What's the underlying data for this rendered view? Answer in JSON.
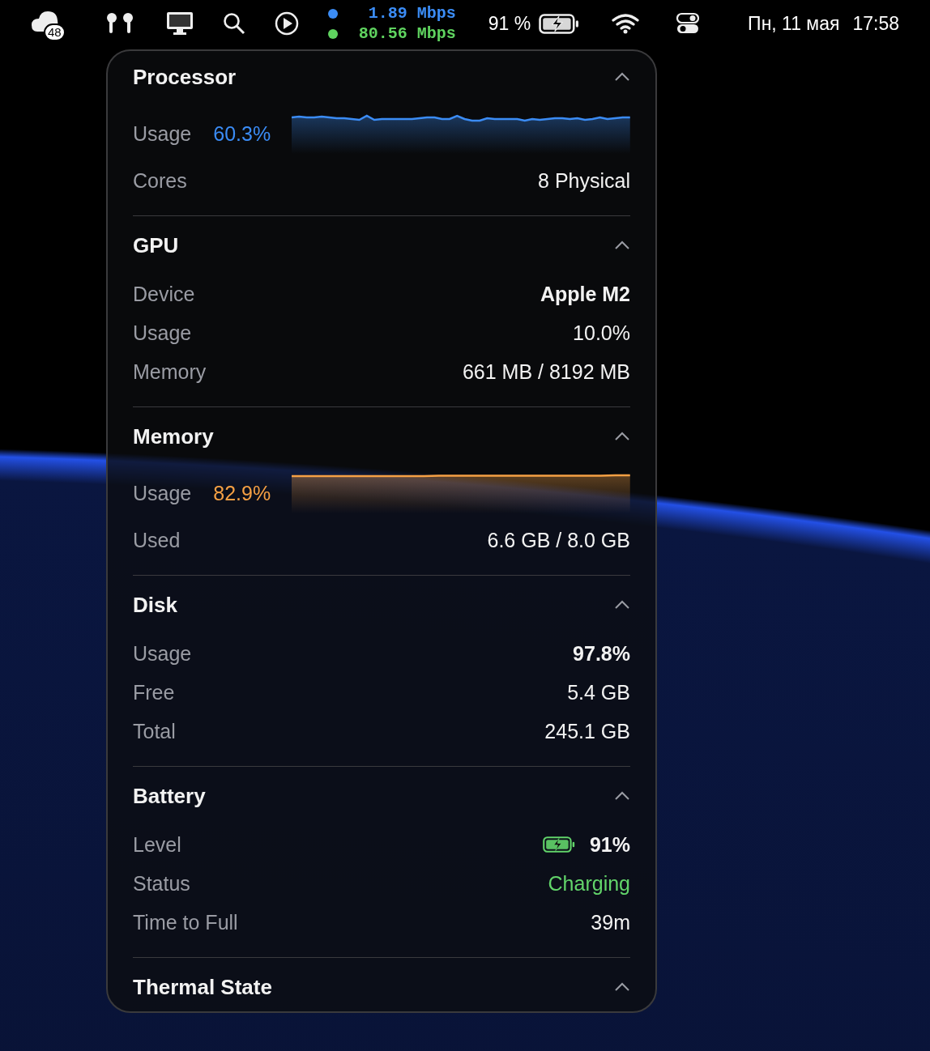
{
  "menu_bar": {
    "badge": "48",
    "network": [
      {
        "rate": "1.89 Mbps",
        "color": "#3b8cf5"
      },
      {
        "rate": "80.56 Mbps",
        "color": "#5fd35f"
      }
    ],
    "battery": "91 %",
    "date": "Пн, 11 мая",
    "time": "17:58"
  },
  "sections": [
    {
      "title": "Processor",
      "expanded": true,
      "rows": [
        {
          "kind": "chart",
          "label": "Usage",
          "value": "60.3%",
          "color": "#3b8cf5"
        },
        {
          "kind": "value",
          "label": "Cores",
          "value": "8 Physical",
          "bold": false
        }
      ]
    },
    {
      "title": "GPU",
      "expanded": true,
      "rows": [
        {
          "kind": "value",
          "label": "Device",
          "value": "Apple M2",
          "bold": true
        },
        {
          "kind": "value",
          "label": "Usage",
          "value": "10.0%",
          "bold": false
        },
        {
          "kind": "value",
          "label": "Memory",
          "value": "661 MB / 8192 MB",
          "bold": false
        }
      ]
    },
    {
      "title": "Memory",
      "expanded": true,
      "rows": [
        {
          "kind": "chart",
          "label": "Usage",
          "value": "82.9%",
          "color": "#f5a044"
        },
        {
          "kind": "value",
          "label": "Used",
          "value": "6.6 GB / 8.0 GB",
          "bold": false
        }
      ]
    },
    {
      "title": "Disk",
      "expanded": true,
      "rows": [
        {
          "kind": "value",
          "label": "Usage",
          "value": "97.8%",
          "bold": true
        },
        {
          "kind": "value",
          "label": "Free",
          "value": "5.4 GB",
          "bold": false
        },
        {
          "kind": "value",
          "label": "Total",
          "value": "245.1 GB",
          "bold": false
        }
      ]
    },
    {
      "title": "Battery",
      "expanded": true,
      "rows": [
        {
          "kind": "battery",
          "label": "Level",
          "value": "91%",
          "bold": true
        },
        {
          "kind": "value",
          "label": "Status",
          "value": "Charging",
          "bold": false,
          "color": "#62d46a"
        },
        {
          "kind": "value",
          "label": "Time to Full",
          "value": "39m",
          "bold": false
        }
      ]
    },
    {
      "title": "Thermal State",
      "expanded": true
    }
  ]
}
